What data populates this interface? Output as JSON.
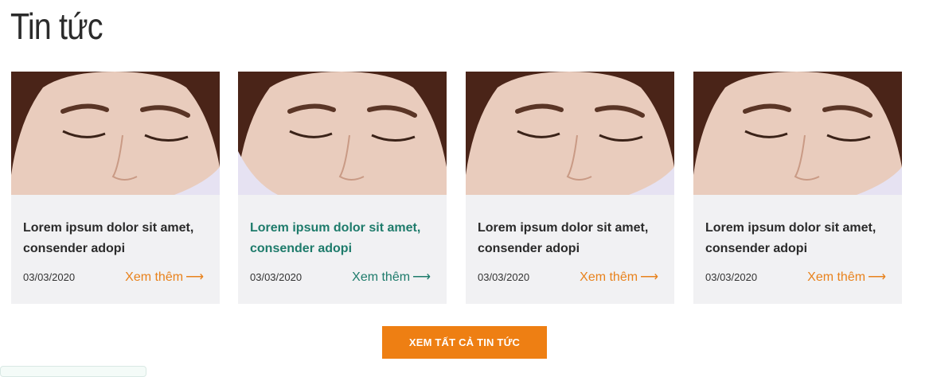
{
  "section": {
    "title": "Tin tức"
  },
  "cards": [
    {
      "headline": "Lorem ipsum dolor sit amet, consender adopi",
      "date": "03/03/2020",
      "more_label": "Xem thêm",
      "arrow": "⟶",
      "state": "normal"
    },
    {
      "headline": "Lorem ipsum dolor sit amet, consender adopi",
      "date": "03/03/2020",
      "more_label": "Xem thêm",
      "arrow": "⟶",
      "state": "hover"
    },
    {
      "headline": "Lorem ipsum dolor sit amet, consender adopi",
      "date": "03/03/2020",
      "more_label": "Xem thêm",
      "arrow": "⟶",
      "state": "normal"
    },
    {
      "headline": "Lorem ipsum dolor sit amet, consender adopi",
      "date": "03/03/2020",
      "more_label": "Xem thêm",
      "arrow": "⟶",
      "state": "normal"
    }
  ],
  "view_all": {
    "label": "XEM TẤT CẢ TIN TỨC"
  },
  "colors": {
    "accent": "#ee7f13",
    "active": "#1e7b6b",
    "card_bg": "#f1f1f3"
  }
}
